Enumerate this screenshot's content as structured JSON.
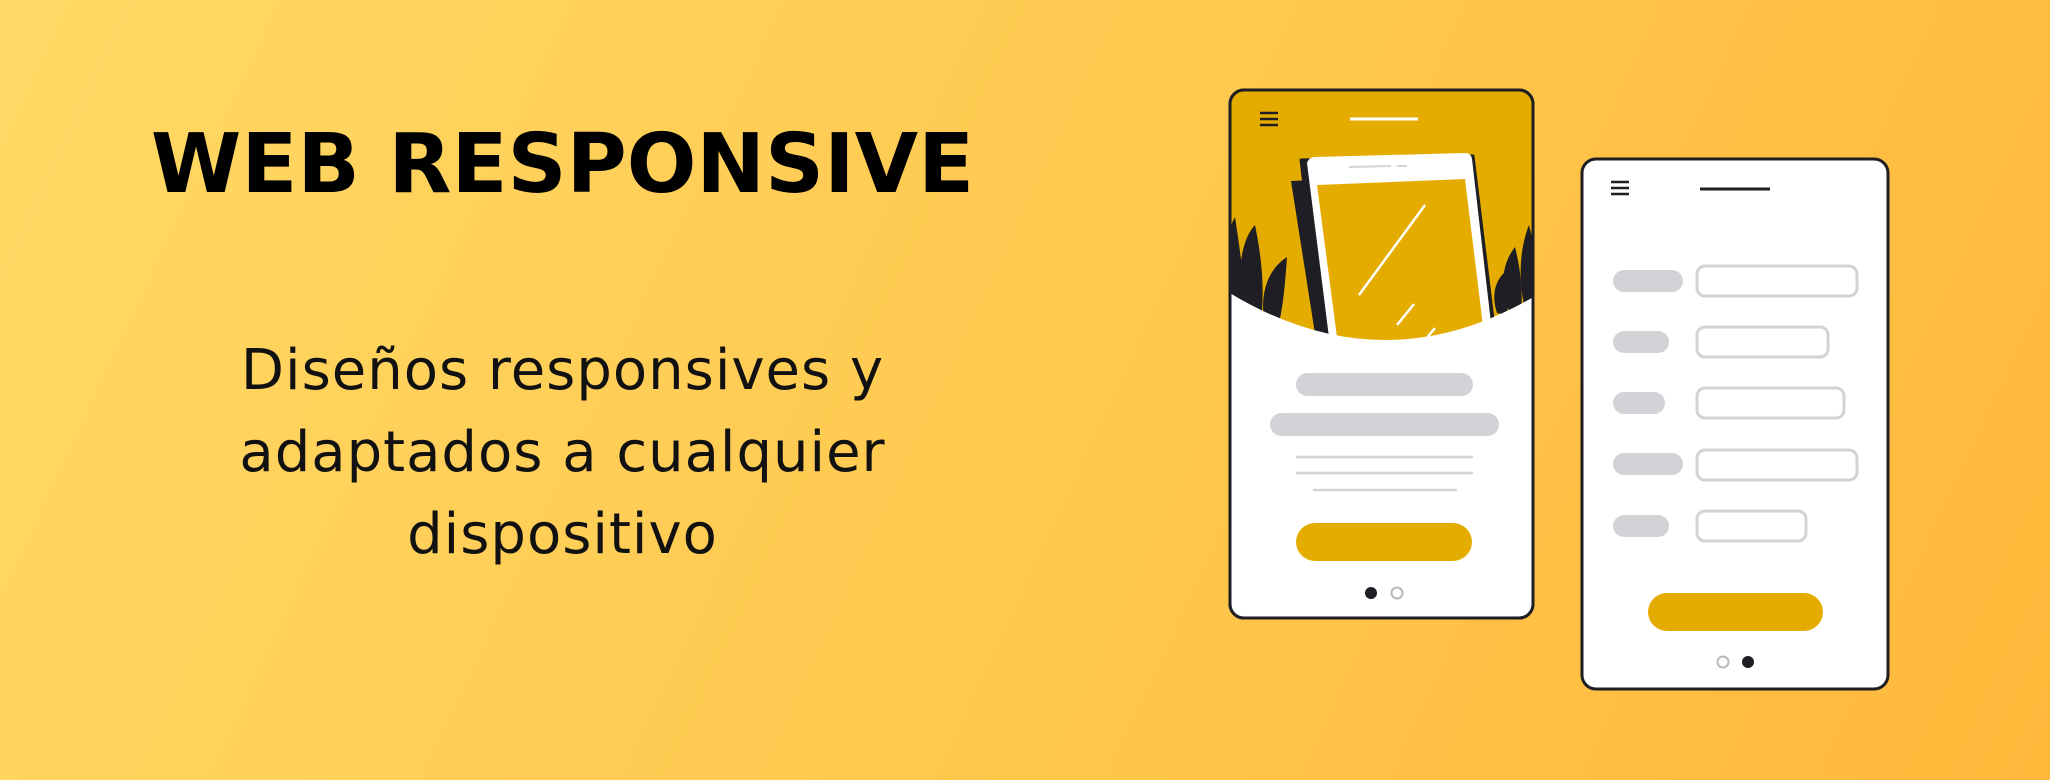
{
  "headline": "WEB RESPONSIVE",
  "subtitle": "Diseños responsives y adaptados a cualquier dispositivo",
  "illustration": {
    "phones": [
      {
        "name": "phone-landing",
        "carousel_active": 1
      },
      {
        "name": "phone-form",
        "carousel_active": 2,
        "form_rows": 5
      }
    ],
    "colors": {
      "accent": "#e5ac00",
      "placeholder": "#d2d3d6",
      "outline": "#1e1e24",
      "screen": "#ffffff"
    },
    "icons": [
      "menu-icon",
      "menu-icon"
    ]
  }
}
